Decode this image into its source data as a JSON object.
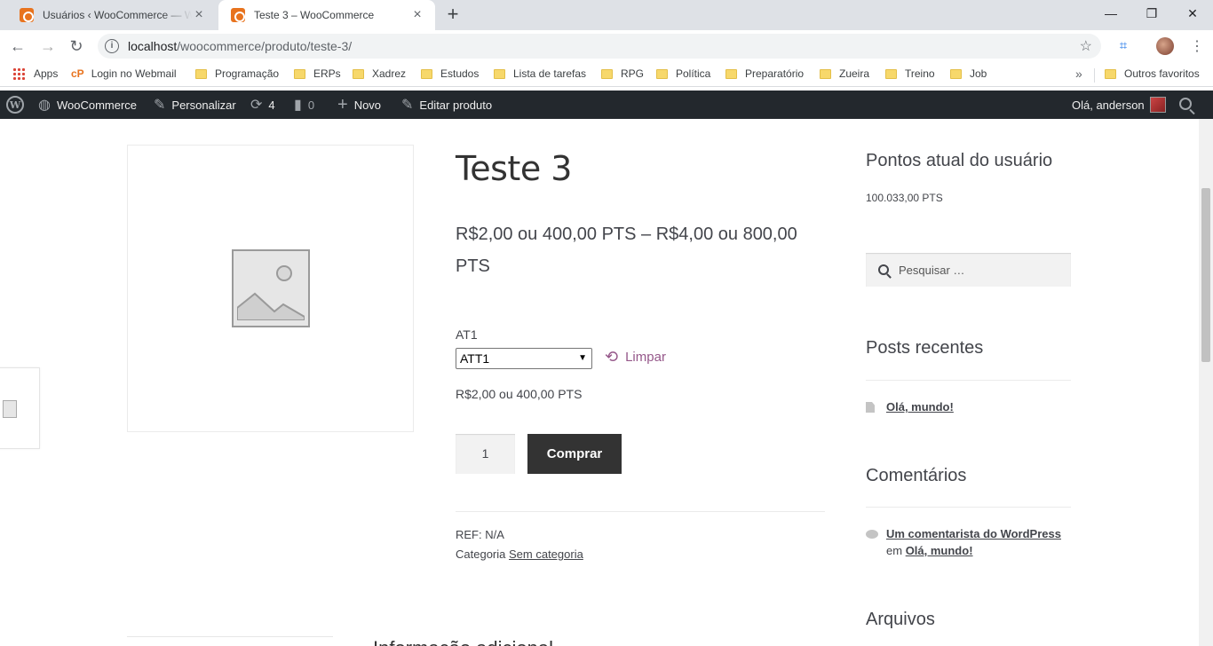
{
  "browser": {
    "tabs": [
      {
        "title": "Usuários ‹ WooCommerce — WordPress",
        "active": false
      },
      {
        "title": "Teste 3 – WooCommerce",
        "active": true
      }
    ],
    "new_tab": "+",
    "window_controls": {
      "minimize": "—",
      "restore": "❐",
      "close": "✕"
    },
    "url_host": "localhost",
    "url_path": "/woocommerce/produto/teste-3/",
    "bookmarks": [
      "Apps",
      "Login no Webmail",
      "Programação",
      "ERPs",
      "Xadrez",
      "Estudos",
      "Lista de tarefas",
      "RPG",
      "Política",
      "Preparatório",
      "Zueira",
      "Treino",
      "Job"
    ],
    "bookmarks_more": "»",
    "other_bookmarks": "Outros favoritos"
  },
  "adminbar": {
    "site": "WooCommerce",
    "customize": "Personalizar",
    "updates": "4",
    "comments": "0",
    "new": "Novo",
    "edit": "Editar produto",
    "greeting": "Olá, anderson"
  },
  "product": {
    "title": "Teste 3",
    "price_range": "R$2,00 ou 400,00 PTS – R$4,00 ou 800,00 PTS",
    "attribute_label": "AT1",
    "attribute_selected": "ATT1",
    "reset_label": "Limpar",
    "variation_price": "R$2,00 ou 400,00 PTS",
    "quantity": "1",
    "buy_label": "Comprar",
    "sku_label": "REF:",
    "sku_value": "N/A",
    "category_label": "Categoria",
    "category_value": "Sem categoria",
    "tab_heading": "Informação adicional"
  },
  "sidebar": {
    "points_title": "Pontos atual do usuário",
    "points_value": "100.033,00 PTS",
    "search_placeholder": "Pesquisar …",
    "recent_title": "Posts recentes",
    "recent_post": "Olá, mundo!",
    "comments_title": "Comentários",
    "comment_author": "Um comentarista do WordPress",
    "comment_on": "em",
    "comment_post": "Olá, mundo!",
    "archives_title": "Arquivos"
  },
  "colors": {
    "accent": "#96588a",
    "adminbar": "#23282d",
    "button": "#333333"
  }
}
